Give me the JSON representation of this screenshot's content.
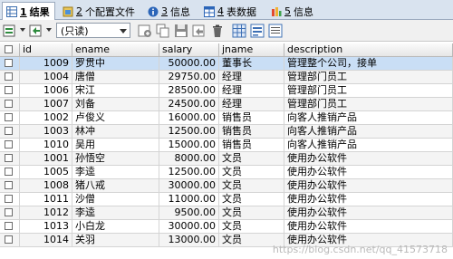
{
  "tabs": [
    {
      "num": "1",
      "label": "结果",
      "icon": "grid-result-icon",
      "active": true
    },
    {
      "num": "2",
      "label": "个配置文件",
      "icon": "profile-icon",
      "active": false
    },
    {
      "num": "3",
      "label": "信息",
      "icon": "info-icon",
      "active": false
    },
    {
      "num": "4",
      "label": "表数据",
      "icon": "table-data-icon",
      "active": false
    },
    {
      "num": "5",
      "label": "信息",
      "icon": "info-history-icon",
      "active": false
    }
  ],
  "toolbar": {
    "mode_value": "(只读)"
  },
  "grid": {
    "columns": [
      "id",
      "ename",
      "salary",
      "jname",
      "description"
    ],
    "rows": [
      {
        "id": "1009",
        "ename": "罗贯中",
        "salary": "50000.00",
        "jname": "董事长",
        "description": "管理整个公司，接单"
      },
      {
        "id": "1004",
        "ename": "唐僧",
        "salary": "29750.00",
        "jname": "经理",
        "description": "管理部门员工"
      },
      {
        "id": "1006",
        "ename": "宋江",
        "salary": "28500.00",
        "jname": "经理",
        "description": "管理部门员工"
      },
      {
        "id": "1007",
        "ename": "刘备",
        "salary": "24500.00",
        "jname": "经理",
        "description": "管理部门员工"
      },
      {
        "id": "1002",
        "ename": "卢俊义",
        "salary": "16000.00",
        "jname": "销售员",
        "description": "向客人推销产品"
      },
      {
        "id": "1003",
        "ename": "林冲",
        "salary": "12500.00",
        "jname": "销售员",
        "description": "向客人推销产品"
      },
      {
        "id": "1010",
        "ename": "吴用",
        "salary": "15000.00",
        "jname": "销售员",
        "description": "向客人推销产品"
      },
      {
        "id": "1001",
        "ename": "孙悟空",
        "salary": "8000.00",
        "jname": "文员",
        "description": "使用办公软件"
      },
      {
        "id": "1005",
        "ename": "李逵",
        "salary": "12500.00",
        "jname": "文员",
        "description": "使用办公软件"
      },
      {
        "id": "1008",
        "ename": "猪八戒",
        "salary": "30000.00",
        "jname": "文员",
        "description": "使用办公软件"
      },
      {
        "id": "1011",
        "ename": "沙僧",
        "salary": "11000.00",
        "jname": "文员",
        "description": "使用办公软件"
      },
      {
        "id": "1012",
        "ename": "李逵",
        "salary": "9500.00",
        "jname": "文员",
        "description": "使用办公软件"
      },
      {
        "id": "1013",
        "ename": "小白龙",
        "salary": "30000.00",
        "jname": "文员",
        "description": "使用办公软件"
      },
      {
        "id": "1014",
        "ename": "关羽",
        "salary": "13000.00",
        "jname": "文员",
        "description": "使用办公软件"
      }
    ]
  },
  "watermark": "https://blog.csdn.net/qq_41573718",
  "colors": {
    "selected_row": "#c9def5",
    "tab_bar": "#d9e3ef",
    "toolbar": "#f0f0f0"
  }
}
